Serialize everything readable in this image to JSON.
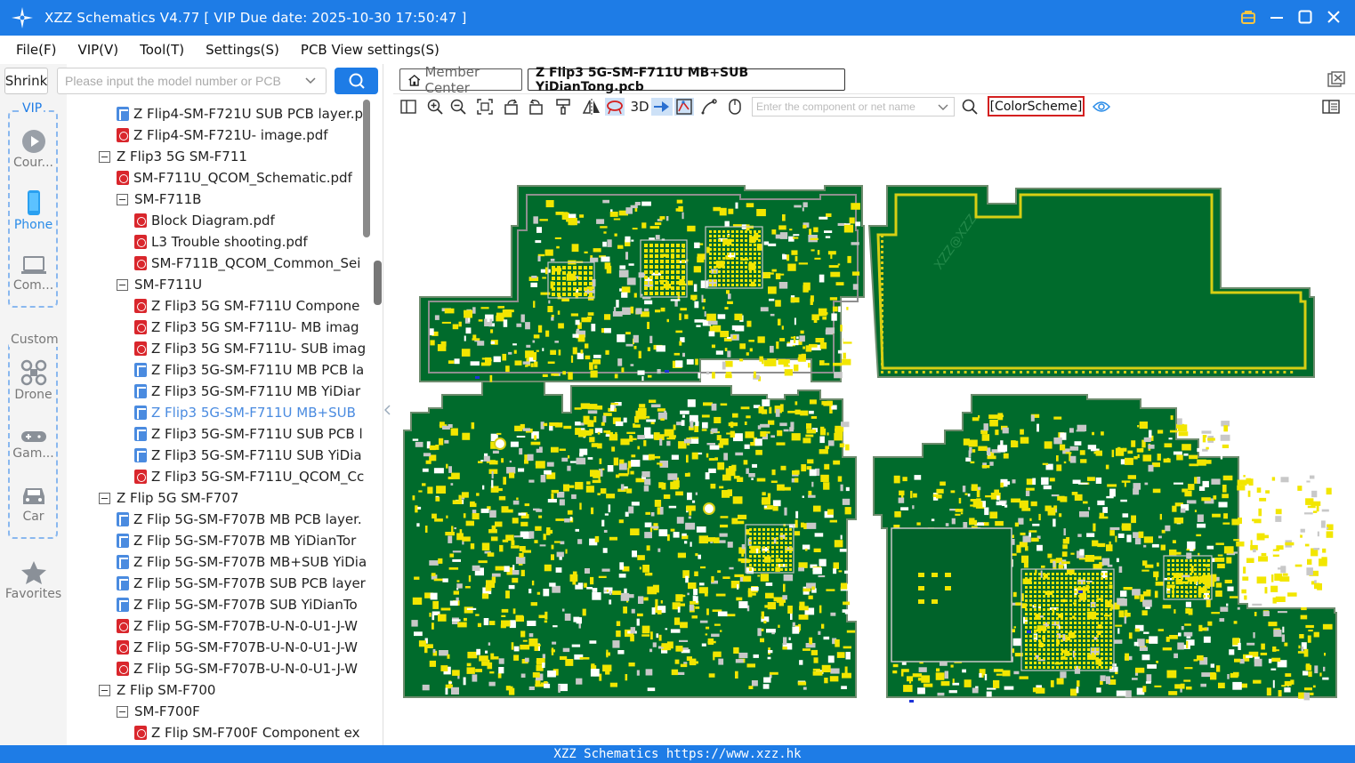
{
  "window": {
    "title": "XZZ Schematics V4.77 [ VIP Due date: 2025-10-30 17:50:47 ]"
  },
  "menu": [
    "File(F)",
    "VIP(V)",
    "Tool(T)",
    "Settings(S)",
    "PCB View settings(S)"
  ],
  "sidebar": {
    "shrink_label": "Shrink",
    "search_placeholder": "Please input the model number or PCB",
    "vip_group_label": "VIP",
    "custom_group_label": "Custom",
    "vip_items": [
      "Cour...",
      "Phone",
      "Com..."
    ],
    "custom_items": [
      "Drone",
      "Gam...",
      "Car"
    ],
    "favorites_label": "Favorites"
  },
  "tree": [
    {
      "label": "Z Flip4-SM-F721U SUB PCB layer.p",
      "type": "pcb"
    },
    {
      "label": "Z Flip4-SM-F721U- image.pdf",
      "type": "pdf"
    },
    {
      "label": "Z Flip3 5G SM-F711",
      "type": "folder"
    },
    {
      "label": "SM-F711U_QCOM_Schematic.pdf",
      "type": "pdf"
    },
    {
      "label": "SM-F711B",
      "type": "folder"
    },
    {
      "label": "Block Diagram.pdf",
      "type": "pdf"
    },
    {
      "label": "L3 Trouble shooting.pdf",
      "type": "pdf"
    },
    {
      "label": "SM-F711B_QCOM_Common_Sei",
      "type": "pdf"
    },
    {
      "label": "SM-F711U",
      "type": "folder"
    },
    {
      "label": "Z Flip3 5G SM-F711U Compone",
      "type": "pdf"
    },
    {
      "label": "Z Flip3 5G SM-F711U- MB imag",
      "type": "pdf"
    },
    {
      "label": "Z Flip3 5G SM-F711U- SUB imag",
      "type": "pdf"
    },
    {
      "label": "Z Flip3 5G-SM-F711U MB PCB la",
      "type": "pcb"
    },
    {
      "label": "Z Flip3 5G-SM-F711U MB YiDiar",
      "type": "pcb"
    },
    {
      "label": "Z Flip3 5G-SM-F711U MB+SUB",
      "type": "pcb",
      "selected": true
    },
    {
      "label": "Z Flip3 5G-SM-F711U SUB PCB l",
      "type": "pcb"
    },
    {
      "label": "Z Flip3 5G-SM-F711U SUB YiDia",
      "type": "pcb"
    },
    {
      "label": "Z Flip3 5G-SM-F711U_QCOM_Cc",
      "type": "pdf"
    },
    {
      "label": "Z Flip 5G SM-F707",
      "type": "folder"
    },
    {
      "label": "Z Flip 5G-SM-F707B MB PCB layer.",
      "type": "pcb"
    },
    {
      "label": "Z Flip 5G-SM-F707B MB YiDianTor",
      "type": "pcb"
    },
    {
      "label": "Z Flip 5G-SM-F707B MB+SUB YiDia",
      "type": "pcb"
    },
    {
      "label": "Z Flip 5G-SM-F707B SUB PCB layer",
      "type": "pcb"
    },
    {
      "label": "Z Flip 5G-SM-F707B SUB YiDianTo",
      "type": "pcb"
    },
    {
      "label": "Z Flip 5G-SM-F707B-U-N-0-U1-J-W",
      "type": "pdf"
    },
    {
      "label": "Z Flip 5G-SM-F707B-U-N-0-U1-J-W",
      "type": "pdf"
    },
    {
      "label": "Z Flip 5G-SM-F707B-U-N-0-U1-J-W",
      "type": "pdf"
    },
    {
      "label": "Z Flip SM-F700",
      "type": "folder"
    },
    {
      "label": "SM-F700F",
      "type": "folder"
    },
    {
      "label": "Z Flip SM-F700F Component ex",
      "type": "pdf"
    }
  ],
  "tabs": {
    "member_center": "Member Center",
    "active_file": "Z Flip3 5G-SM-F711U MB+SUB YiDianTong.pcb"
  },
  "toolbar": {
    "three_d_label": "3D",
    "component_search_placeholder": "Enter the component or net name",
    "color_scheme_label": "[ColorScheme]"
  },
  "canvas": {
    "watermark_text": "XZZ@XZZ",
    "colors": {
      "board": "#006b2c",
      "pad": "#f2e600",
      "outline": "#8f8f8f"
    }
  },
  "status_bar": "XZZ Schematics https://www.xzz.hk",
  "colors": {
    "accent": "#1e7ce6",
    "highlight_border": "#d42020"
  }
}
